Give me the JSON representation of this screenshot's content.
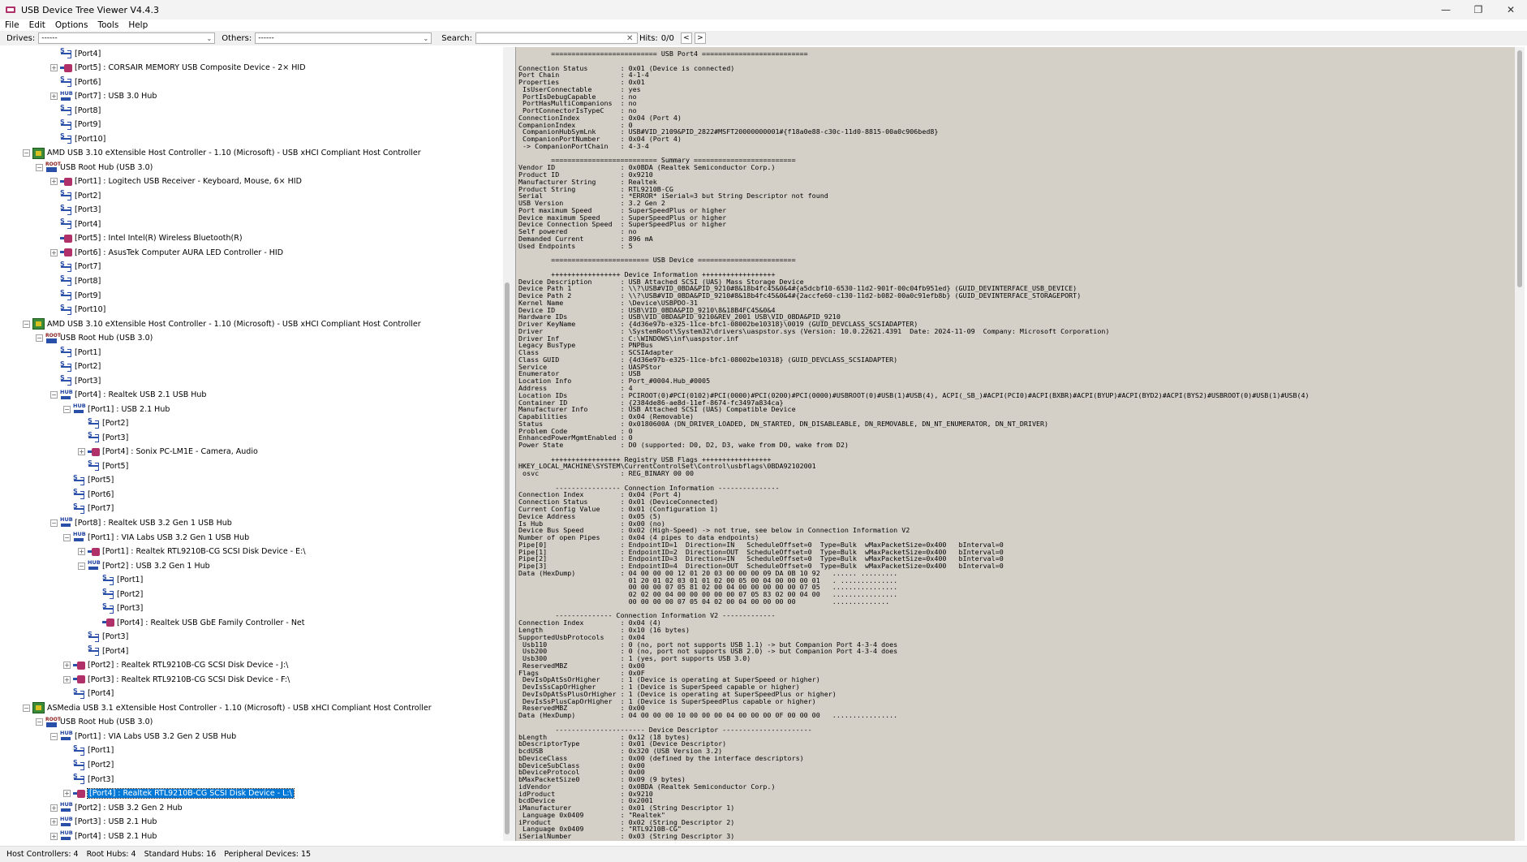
{
  "window": {
    "title": "USB Device Tree Viewer V4.4.3",
    "min": "—",
    "max": "❐",
    "close": "✕"
  },
  "menu": [
    "File",
    "Edit",
    "Options",
    "Tools",
    "Help"
  ],
  "toolbar": {
    "drives_label": "Drives:",
    "drives_value": "------",
    "others_label": "Others:",
    "others_value": "------",
    "search_label": "Search:",
    "search_value": "",
    "hits_label": "Hits:",
    "hits_value": "0/0",
    "prev": "<",
    "next": ">"
  },
  "tree": [
    {
      "lvl": 3,
      "exp": "",
      "icon": "port",
      "text": "[Port4]"
    },
    {
      "lvl": 3,
      "exp": "+",
      "icon": "dev",
      "text": "[Port5] : CORSAIR MEMORY USB Composite Device - 2× HID"
    },
    {
      "lvl": 3,
      "exp": "",
      "icon": "port",
      "text": "[Port6]"
    },
    {
      "lvl": 3,
      "exp": "+",
      "icon": "hub",
      "text": "[Port7] : USB 3.0 Hub"
    },
    {
      "lvl": 3,
      "exp": "",
      "icon": "port",
      "text": "[Port8]"
    },
    {
      "lvl": 3,
      "exp": "",
      "icon": "port",
      "text": "[Port9]"
    },
    {
      "lvl": 3,
      "exp": "",
      "icon": "port",
      "text": "[Port10]"
    },
    {
      "lvl": 1,
      "exp": "−",
      "icon": "ctrl",
      "text": "AMD USB 3.10 eXtensible Host Controller - 1.10 (Microsoft) - USB xHCI Compliant Host Controller"
    },
    {
      "lvl": 2,
      "exp": "−",
      "icon": "root",
      "text": "USB Root Hub (USB 3.0)"
    },
    {
      "lvl": 3,
      "exp": "+",
      "icon": "dev",
      "text": "[Port1] : Logitech USB Receiver - Keyboard, Mouse, 6× HID"
    },
    {
      "lvl": 3,
      "exp": "",
      "icon": "port",
      "text": "[Port2]"
    },
    {
      "lvl": 3,
      "exp": "",
      "icon": "port",
      "text": "[Port3]"
    },
    {
      "lvl": 3,
      "exp": "",
      "icon": "port",
      "text": "[Port4]"
    },
    {
      "lvl": 3,
      "exp": "",
      "icon": "dev",
      "text": "[Port5] : Intel Intel(R) Wireless Bluetooth(R)"
    },
    {
      "lvl": 3,
      "exp": "+",
      "icon": "dev",
      "text": "[Port6] : AsusTek Computer AURA LED Controller - HID"
    },
    {
      "lvl": 3,
      "exp": "",
      "icon": "port",
      "text": "[Port7]"
    },
    {
      "lvl": 3,
      "exp": "",
      "icon": "port",
      "text": "[Port8]"
    },
    {
      "lvl": 3,
      "exp": "",
      "icon": "port",
      "text": "[Port9]"
    },
    {
      "lvl": 3,
      "exp": "",
      "icon": "port",
      "text": "[Port10]"
    },
    {
      "lvl": 1,
      "exp": "−",
      "icon": "ctrl",
      "text": "AMD USB 3.10 eXtensible Host Controller - 1.10 (Microsoft) - USB xHCI Compliant Host Controller"
    },
    {
      "lvl": 2,
      "exp": "−",
      "icon": "root",
      "text": "USB Root Hub (USB 3.0)"
    },
    {
      "lvl": 3,
      "exp": "",
      "icon": "port",
      "text": "[Port1]"
    },
    {
      "lvl": 3,
      "exp": "",
      "icon": "port",
      "text": "[Port2]"
    },
    {
      "lvl": 3,
      "exp": "",
      "icon": "port",
      "text": "[Port3]"
    },
    {
      "lvl": 3,
      "exp": "−",
      "icon": "hub",
      "text": "[Port4] : Realtek USB 2.1 USB Hub"
    },
    {
      "lvl": 4,
      "exp": "−",
      "icon": "hub",
      "text": "[Port1] : USB 2.1 Hub"
    },
    {
      "lvl": 5,
      "exp": "",
      "icon": "port",
      "text": "[Port2]"
    },
    {
      "lvl": 5,
      "exp": "",
      "icon": "port",
      "text": "[Port3]"
    },
    {
      "lvl": 5,
      "exp": "+",
      "icon": "dev",
      "text": "[Port4] : Sonix PC-LM1E - Camera, Audio"
    },
    {
      "lvl": 5,
      "exp": "",
      "icon": "port",
      "text": "[Port5]"
    },
    {
      "lvl": 4,
      "exp": "",
      "icon": "port",
      "text": "[Port5]"
    },
    {
      "lvl": 4,
      "exp": "",
      "icon": "port",
      "text": "[Port6]"
    },
    {
      "lvl": 4,
      "exp": "",
      "icon": "port",
      "text": "[Port7]"
    },
    {
      "lvl": 3,
      "exp": "−",
      "icon": "hub",
      "text": "[Port8] : Realtek USB 3.2 Gen 1 USB Hub"
    },
    {
      "lvl": 4,
      "exp": "−",
      "icon": "hub",
      "text": "[Port1] : VIA Labs USB 3.2 Gen 1 USB Hub"
    },
    {
      "lvl": 5,
      "exp": "+",
      "icon": "dev",
      "text": "[Port1] : Realtek RTL9210B-CG SCSI Disk Device - E:\\"
    },
    {
      "lvl": 5,
      "exp": "−",
      "icon": "hub",
      "text": "[Port2] : USB 3.2 Gen 1 Hub"
    },
    {
      "lvl": 6,
      "exp": "",
      "icon": "port",
      "text": "[Port1]"
    },
    {
      "lvl": 6,
      "exp": "",
      "icon": "port",
      "text": "[Port2]"
    },
    {
      "lvl": 6,
      "exp": "",
      "icon": "port",
      "text": "[Port3]"
    },
    {
      "lvl": 6,
      "exp": "",
      "icon": "dev",
      "text": "[Port4] : Realtek USB GbE Family Controller - Net"
    },
    {
      "lvl": 5,
      "exp": "",
      "icon": "port",
      "text": "[Port3]"
    },
    {
      "lvl": 5,
      "exp": "",
      "icon": "port",
      "text": "[Port4]"
    },
    {
      "lvl": 4,
      "exp": "+",
      "icon": "dev",
      "text": "[Port2] : Realtek RTL9210B-CG SCSI Disk Device - J:\\"
    },
    {
      "lvl": 4,
      "exp": "+",
      "icon": "dev",
      "text": "[Port3] : Realtek RTL9210B-CG SCSI Disk Device - F:\\"
    },
    {
      "lvl": 4,
      "exp": "",
      "icon": "port",
      "text": "[Port4]"
    },
    {
      "lvl": 1,
      "exp": "−",
      "icon": "ctrl",
      "text": "ASMedia USB 3.1 eXtensible Host Controller - 1.10 (Microsoft) - USB xHCI Compliant Host Controller"
    },
    {
      "lvl": 2,
      "exp": "−",
      "icon": "root",
      "text": "USB Root Hub (USB 3.0)"
    },
    {
      "lvl": 3,
      "exp": "−",
      "icon": "hub",
      "text": "[Port1] : VIA Labs USB 3.2 Gen 2 USB Hub"
    },
    {
      "lvl": 4,
      "exp": "",
      "icon": "port",
      "text": "[Port1]"
    },
    {
      "lvl": 4,
      "exp": "",
      "icon": "port",
      "text": "[Port2]"
    },
    {
      "lvl": 4,
      "exp": "",
      "icon": "port",
      "text": "[Port3]"
    },
    {
      "lvl": 4,
      "exp": "+",
      "icon": "dev",
      "text": "[Port4] : Realtek RTL9210B-CG SCSI Disk Device - L:\\",
      "selected": true
    },
    {
      "lvl": 3,
      "exp": "+",
      "icon": "hub",
      "text": "[Port2] : USB 3.2 Gen 2 Hub"
    },
    {
      "lvl": 3,
      "exp": "+",
      "icon": "hub",
      "text": "[Port3] : USB 2.1 Hub"
    },
    {
      "lvl": 3,
      "exp": "+",
      "icon": "hub",
      "text": "[Port4] : USB 2.1 Hub"
    }
  ],
  "detail_lines": [
    "        ========================== USB Port4 ==========================",
    "",
    "Connection Status        : 0x01 (Device is connected)",
    "Port Chain               : 4-1-4",
    "Properties               : 0x01",
    " IsUserConnectable       : yes",
    " PortIsDebugCapable      : no",
    " PortHasMultiCompanions  : no",
    " PortConnectorIsTypeC    : no",
    "ConnectionIndex          : 0x04 (Port 4)",
    "CompanionIndex           : 0",
    " CompanionHubSymLnk      : USB#VID_2109&PID_2822#MSFT20000000001#{f18a0e88-c30c-11d0-8815-00a0c906bed8}",
    " CompanionPortNumber     : 0x04 (Port 4)",
    " -> CompanionPortChain   : 4-3-4",
    "",
    "        ========================== Summary =========================",
    "Vendor ID                : 0x0BDA (Realtek Semiconductor Corp.)",
    "Product ID               : 0x9210",
    "Manufacturer String      : Realtek",
    "Product String           : RTL9210B-CG",
    "Serial                   : *ERROR* iSerial=3 but String Descriptor not found",
    "USB Version              : 3.2 Gen 2",
    "Port maximum Speed       : SuperSpeedPlus or higher",
    "Device maximum Speed     : SuperSpeedPlus or higher",
    "Device Connection Speed  : SuperSpeedPlus or higher",
    "Self powered             : no",
    "Demanded Current         : 896 mA",
    "Used Endpoints           : 5",
    "",
    "        ======================== USB Device ========================",
    "",
    "        +++++++++++++++++ Device Information ++++++++++++++++++",
    "Device Description       : USB Attached SCSI (UAS) Mass Storage Device",
    "Device Path 1            : \\\\?\\USB#VID_0BDA&PID_9210#8&18b4fc45&0&4#{a5dcbf10-6530-11d2-901f-00c04fb951ed} (GUID_DEVINTERFACE_USB_DEVICE)",
    "Device Path 2            : \\\\?\\USB#VID_0BDA&PID_9210#8&18b4fc45&0&4#{2accfe60-c130-11d2-b082-00a0c91efb8b} (GUID_DEVINTERFACE_STORAGEPORT)",
    "Kernel Name              : \\Device\\USBPDO-31",
    "Device ID                : USB\\VID_0BDA&PID_9210\\8&18B4FC45&0&4",
    "Hardware IDs             : USB\\VID_0BDA&PID_9210&REV_2001 USB\\VID_0BDA&PID_9210",
    "Driver KeyName           : {4d36e97b-e325-11ce-bfc1-08002be10318}\\0019 (GUID_DEVCLASS_SCSIADAPTER)",
    "Driver                   : \\SystemRoot\\System32\\drivers\\uaspstor.sys (Version: 10.0.22621.4391  Date: 2024-11-09  Company: Microsoft Corporation)",
    "Driver Inf               : C:\\WINDOWS\\inf\\uaspstor.inf",
    "Legacy BusType           : PNPBus",
    "Class                    : SCSIAdapter",
    "Class GUID               : {4d36e97b-e325-11ce-bfc1-08002be10318} (GUID_DEVCLASS_SCSIADAPTER)",
    "Service                  : UASPStor",
    "Enumerator               : USB",
    "Location Info            : Port_#0004.Hub_#0005",
    "Address                  : 4",
    "Location IDs             : PCIROOT(0)#PCI(0102)#PCI(0000)#PCI(0200)#PCI(0000)#USBROOT(0)#USB(1)#USB(4), ACPI(_SB_)#ACPI(PCI0)#ACPI(BXBR)#ACPI(BYUP)#ACPI(BYD2)#ACPI(BYS2)#USBROOT(0)#USB(1)#USB(4)",
    "Container ID             : {2384de86-ae8d-11ef-8674-fc3497a834ca}",
    "Manufacturer Info        : USB Attached SCSI (UAS) Compatible Device",
    "Capabilities             : 0x04 (Removable)",
    "Status                   : 0x0180600A (DN_DRIVER_LOADED, DN_STARTED, DN_DISABLEABLE, DN_REMOVABLE, DN_NT_ENUMERATOR, DN_NT_DRIVER)",
    "Problem Code             : 0",
    "EnhancedPowerMgmtEnabled : 0",
    "Power State              : D0 (supported: D0, D2, D3, wake from D0, wake from D2)",
    "",
    "        +++++++++++++++++ Registry USB Flags +++++++++++++++++",
    "HKEY_LOCAL_MACHINE\\SYSTEM\\CurrentControlSet\\Control\\usbflags\\0BDA92102001",
    " osvc                    : REG_BINARY 00 00",
    "",
    "         ---------------- Connection Information ---------------",
    "Connection Index         : 0x04 (Port 4)",
    "Connection Status        : 0x01 (DeviceConnected)",
    "Current Config Value     : 0x01 (Configuration 1)",
    "Device Address           : 0x05 (5)",
    "Is Hub                   : 0x00 (no)",
    "Device Bus Speed         : 0x02 (High-Speed) -> not true, see below in Connection Information V2",
    "Number of open Pipes     : 0x04 (4 pipes to data endpoints)",
    "Pipe[0]                  : EndpointID=1  Direction=IN   ScheduleOffset=0  Type=Bulk  wMaxPacketSize=0x400   bInterval=0",
    "Pipe[1]                  : EndpointID=2  Direction=OUT  ScheduleOffset=0  Type=Bulk  wMaxPacketSize=0x400   bInterval=0",
    "Pipe[2]                  : EndpointID=3  Direction=IN   ScheduleOffset=0  Type=Bulk  wMaxPacketSize=0x400   bInterval=0",
    "Pipe[3]                  : EndpointID=4  Direction=OUT  ScheduleOffset=0  Type=Bulk  wMaxPacketSize=0x400   bInterval=0",
    "Data (HexDump)           : 04 00 00 00 12 01 20 03 00 00 00 09 DA 0B 10 92   ...... .........",
    "                           01 20 01 02 03 01 01 02 00 05 00 04 00 00 00 01   . ..............",
    "                           00 00 00 07 05 81 02 00 04 00 00 00 00 00 07 05   ................",
    "                           02 02 00 04 00 00 00 00 00 07 05 83 02 00 04 00   ................",
    "                           00 00 00 00 07 05 04 02 00 04 00 00 00 00         ..............",
    "",
    "         -------------- Connection Information V2 -------------",
    "Connection Index         : 0x04 (4)",
    "Length                   : 0x10 (16 bytes)",
    "SupportedUsbProtocols    : 0x04",
    " Usb110                  : 0 (no, port not supports USB 1.1) -> but Companion Port 4-3-4 does",
    " Usb200                  : 0 (no, port not supports USB 2.0) -> but Companion Port 4-3-4 does",
    " Usb300                  : 1 (yes, port supports USB 3.0)",
    " ReservedMBZ             : 0x00",
    "Flags                    : 0x0F",
    " DevIsOpAtSsOrHigher     : 1 (Device is operating at SuperSpeed or higher)",
    " DevIsSsCapOrHigher      : 1 (Device is SuperSpeed capable or higher)",
    " DevIsOpAtSsPlusOrHigher : 1 (Device is operating at SuperSpeedPlus or higher)",
    " DevIsSsPlusCapOrHigher  : 1 (Device is SuperSpeedPlus capable or higher)",
    " ReservedMBZ             : 0x00",
    "Data (HexDump)           : 04 00 00 00 10 00 00 00 04 00 00 00 0F 00 00 00   ................",
    "",
    "         ---------------------- Device Descriptor ----------------------",
    "bLength                  : 0x12 (18 bytes)",
    "bDescriptorType          : 0x01 (Device Descriptor)",
    "bcdUSB                   : 0x320 (USB Version 3.2)",
    "bDeviceClass             : 0x00 (defined by the interface descriptors)",
    "bDeviceSubClass          : 0x00",
    "bDeviceProtocol          : 0x00",
    "bMaxPacketSize0          : 0x09 (9 bytes)",
    "idVendor                 : 0x0BDA (Realtek Semiconductor Corp.)",
    "idProduct                : 0x9210",
    "bcdDevice                : 0x2001",
    "iManufacturer            : 0x01 (String Descriptor 1)",
    " Language 0x0409         : \"Realtek\"",
    "iProduct                 : 0x02 (String Descriptor 2)",
    " Language 0x0409         : \"RTL9210B-CG\"",
    "iSerialNumber            : 0x03 (String Descriptor 3)"
  ],
  "status": {
    "host": "Host Controllers: 4",
    "root": "Root Hubs: 4",
    "standard": "Standard Hubs: 16",
    "peripheral": "Peripheral Devices: 15"
  }
}
